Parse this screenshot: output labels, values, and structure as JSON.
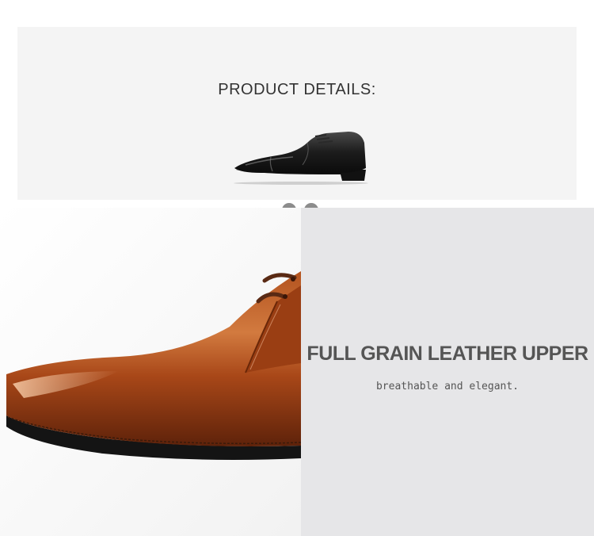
{
  "details": {
    "title": "PRODUCT DETAILS:",
    "image": "black-oxford-shoe",
    "carousel": {
      "total_slides": 2
    }
  },
  "feature": {
    "image": "brown-leather-shoe-closeup",
    "title": "FULL GRAIN LEATHER UPPER",
    "subtitle": "breathable and elegant."
  },
  "colors": {
    "header_bg": "#f4f4f4",
    "panel_bg": "#e6e6e8",
    "dot": "#8c8c8c",
    "leather": "#a0441b"
  }
}
